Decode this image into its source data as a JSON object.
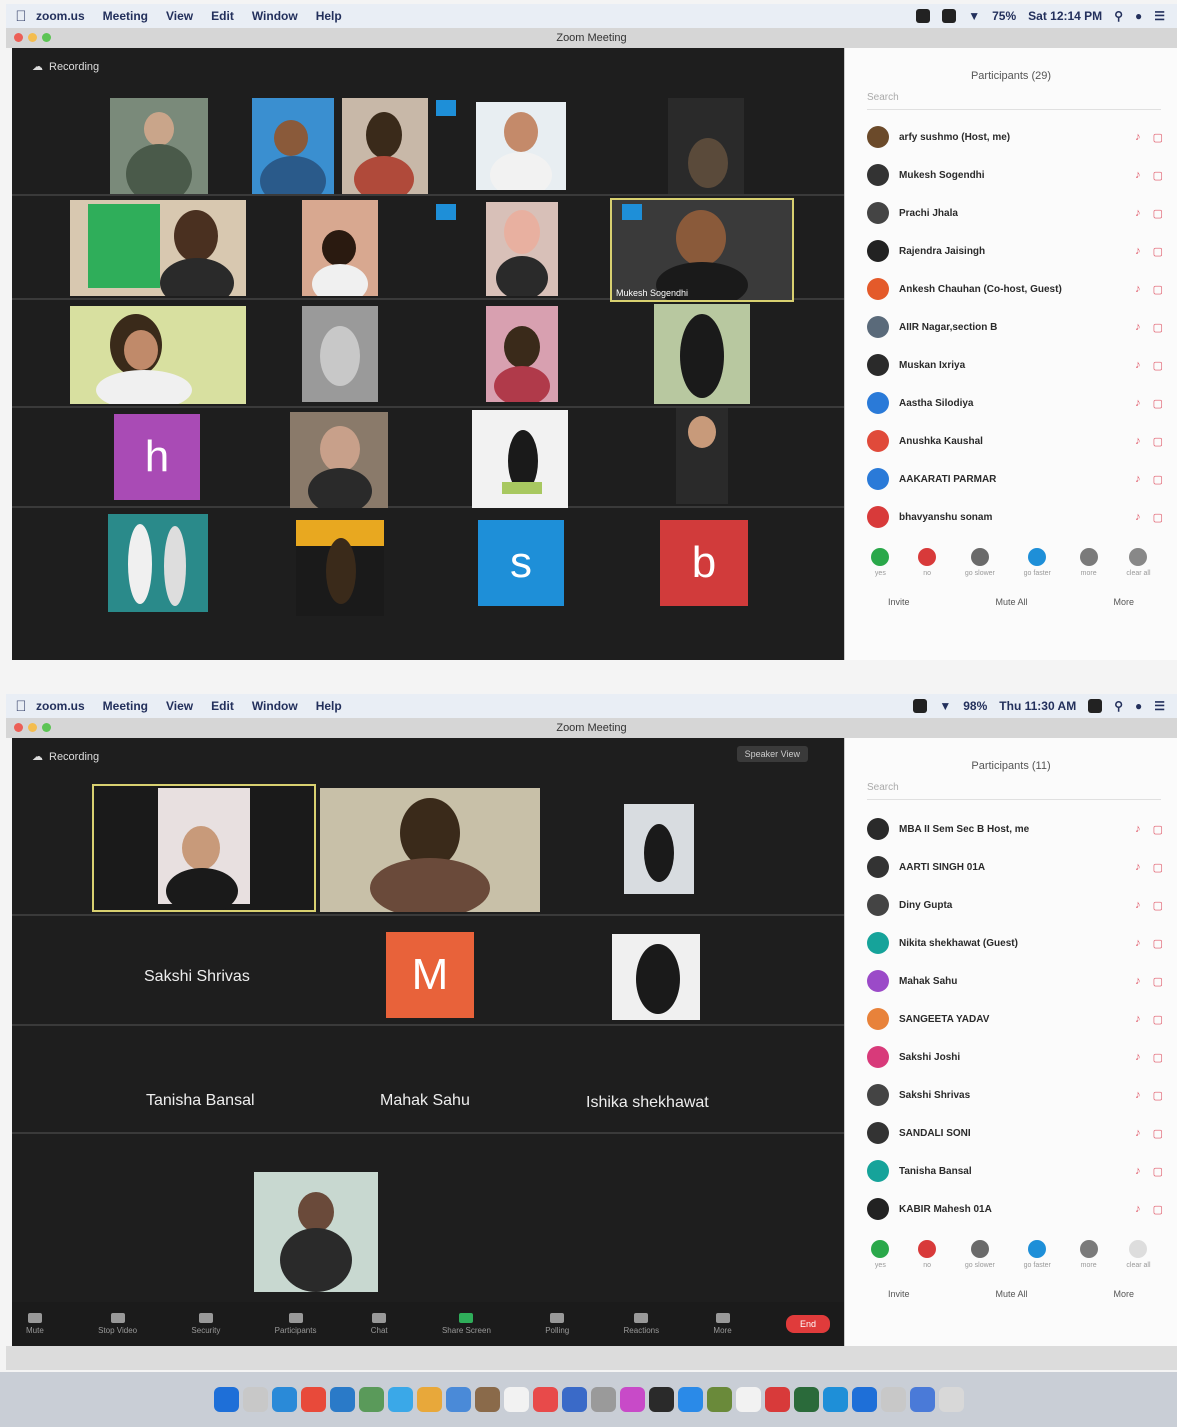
{
  "top": {
    "menubar": {
      "app": "zoom.us",
      "items": [
        "Meeting",
        "View",
        "Edit",
        "Window",
        "Help"
      ],
      "battery": "75%",
      "clock": "Sat 12:14 PM"
    },
    "window_title": "Zoom Meeting",
    "recording_label": "Recording",
    "avatars": [
      {
        "letter": "h",
        "color": "#a94bb5"
      },
      {
        "letter": "s",
        "color": "#1e8fd8"
      },
      {
        "letter": "b",
        "color": "#d13b3b"
      }
    ],
    "highlight_tile_name": "Mukesh Sogendhi",
    "participants_title": "Participants (29)",
    "search_placeholder": "Search",
    "participants": [
      {
        "name": "arfy sushmo (Host, me)",
        "color": "#6b4a2a"
      },
      {
        "name": "Mukesh Sogendhi",
        "color": "#333333"
      },
      {
        "name": "Prachi Jhala",
        "color": "#444444"
      },
      {
        "name": "Rajendra Jaisingh",
        "color": "#222222"
      },
      {
        "name": "Ankesh Chauhan (Co-host, Guest)",
        "color": "#e45a2a"
      },
      {
        "name": "AIIR Nagar,section B",
        "color": "#5a6a7a"
      },
      {
        "name": "Muskan Ixriya",
        "color": "#2a2a2a"
      },
      {
        "name": "Aastha Silodiya",
        "color": "#2a7ad8"
      },
      {
        "name": "Anushka Kaushal",
        "color": "#e04a3a"
      },
      {
        "name": "AAKARATI PARMAR",
        "color": "#2a7ad8"
      },
      {
        "name": "bhavyanshu sonam",
        "color": "#d83a3a"
      }
    ],
    "feedback": [
      {
        "label": "yes",
        "color": "#2aa84a"
      },
      {
        "label": "no",
        "color": "#d83a3a"
      },
      {
        "label": "go slower",
        "color": "#6a6a6a"
      },
      {
        "label": "go faster",
        "color": "#1e8fd8"
      },
      {
        "label": "more",
        "color": "#7a7a7a"
      },
      {
        "label": "clear all",
        "color": "#888888"
      }
    ],
    "buttons": [
      "Invite",
      "Mute All",
      "More"
    ]
  },
  "bottom": {
    "menubar": {
      "app": "zoom.us",
      "items": [
        "Meeting",
        "View",
        "Edit",
        "Window",
        "Help"
      ],
      "battery": "98%",
      "clock": "Thu 11:30 AM"
    },
    "window_title": "Zoom Meeting",
    "recording_label": "Recording",
    "speaker_view": "Speaker View",
    "named_tiles": [
      "Sakshi Shrivas",
      "Tanisha Bansal",
      "Mahak Sahu",
      "Ishika shekhawat"
    ],
    "avatar_m": {
      "letter": "M",
      "color": "#e8623a"
    },
    "participants_title": "Participants (11)",
    "search_placeholder": "Search",
    "participants": [
      {
        "name": "MBA II Sem Sec B Host, me",
        "color": "#2a2a2a"
      },
      {
        "name": "AARTI SINGH 01A",
        "color": "#333333"
      },
      {
        "name": "Diny Gupta",
        "color": "#444444"
      },
      {
        "name": "Nikita shekhawat (Guest)",
        "color": "#16a39a"
      },
      {
        "name": "Mahak Sahu",
        "color": "#9b4ac8"
      },
      {
        "name": "SANGEETA YADAV",
        "color": "#e8823a"
      },
      {
        "name": "Sakshi Joshi",
        "color": "#d83a7a"
      },
      {
        "name": "Sakshi Shrivas",
        "color": "#444444"
      },
      {
        "name": "SANDALI SONI",
        "color": "#333333"
      },
      {
        "name": "Tanisha Bansal",
        "color": "#16a39a"
      },
      {
        "name": "KABIR Mahesh 01A",
        "color": "#222222"
      }
    ],
    "feedback": [
      {
        "label": "yes",
        "color": "#2aa84a"
      },
      {
        "label": "no",
        "color": "#d83a3a"
      },
      {
        "label": "go slower",
        "color": "#6a6a6a"
      },
      {
        "label": "go faster",
        "color": "#1e8fd8"
      },
      {
        "label": "more",
        "color": "#7a7a7a"
      },
      {
        "label": "clear all",
        "color": "#dddddd"
      }
    ],
    "buttons": [
      "Invite",
      "Mute All",
      "More"
    ],
    "toolbar": [
      "Mute",
      "Stop Video",
      "Security",
      "Participants",
      "Chat",
      "Share Screen",
      "Polling",
      "Reactions",
      "More"
    ],
    "end": "End"
  }
}
